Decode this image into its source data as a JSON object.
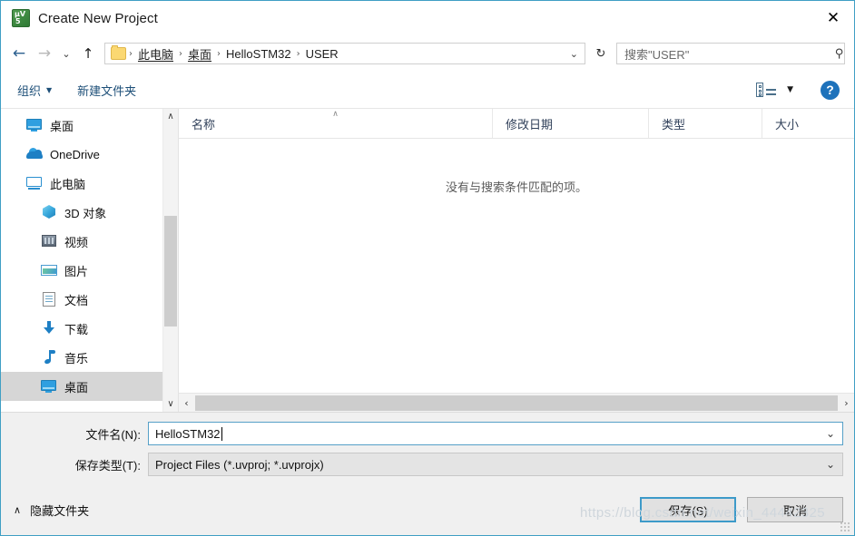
{
  "window": {
    "title": "Create New Project",
    "app_icon": "uvision-logo-icon",
    "close_label": "✕"
  },
  "navigation": {
    "back": "←",
    "forward": "→",
    "recent": "⌄",
    "up": "↑",
    "refresh": "↻",
    "dropdown": "⌄",
    "breadcrumbs": [
      {
        "label": "此电脑"
      },
      {
        "label": "桌面"
      },
      {
        "label": "HelloSTM32"
      },
      {
        "label": "USER"
      }
    ],
    "separator": "›"
  },
  "search": {
    "placeholder": "搜索\"USER\"",
    "icon": "⚲"
  },
  "toolbar": {
    "organize_label": "组织",
    "organize_caret": "▼",
    "new_folder_label": "新建文件夹",
    "view_caret": "▼",
    "help_label": "?"
  },
  "sidebar": {
    "items": [
      {
        "label": "桌面",
        "icon": "desktop-icon",
        "indent": 0,
        "selected": false
      },
      {
        "label": "OneDrive",
        "icon": "onedrive-cloud-icon",
        "indent": 0,
        "selected": false
      },
      {
        "label": "此电脑",
        "icon": "this-pc-icon",
        "indent": 0,
        "selected": false
      },
      {
        "label": "3D 对象",
        "icon": "3d-objects-icon",
        "indent": 1,
        "selected": false
      },
      {
        "label": "视频",
        "icon": "videos-icon",
        "indent": 1,
        "selected": false
      },
      {
        "label": "图片",
        "icon": "pictures-icon",
        "indent": 1,
        "selected": false
      },
      {
        "label": "文档",
        "icon": "documents-icon",
        "indent": 1,
        "selected": false
      },
      {
        "label": "下载",
        "icon": "downloads-icon",
        "indent": 1,
        "selected": false
      },
      {
        "label": "音乐",
        "icon": "music-icon",
        "indent": 1,
        "selected": false
      },
      {
        "label": "桌面",
        "icon": "desktop-icon",
        "indent": 1,
        "selected": true
      }
    ],
    "scroll_up": "∧",
    "scroll_down": "∨"
  },
  "filelist": {
    "columns": [
      {
        "label": "名称",
        "sorted": "asc",
        "sort_caret": "∧"
      },
      {
        "label": "修改日期",
        "sorted": ""
      },
      {
        "label": "类型",
        "sorted": ""
      },
      {
        "label": "大小",
        "sorted": ""
      }
    ],
    "empty_message": "没有与搜索条件匹配的项。",
    "scroll_left": "‹",
    "scroll_right": "›"
  },
  "form": {
    "filename_label": "文件名(N):",
    "filename_value": "HelloSTM32",
    "filetype_label": "保存类型(T):",
    "filetype_value": "Project Files (*.uvproj; *.uvprojx)",
    "combo_chevron": "⌄"
  },
  "actions": {
    "hide_folders_caret": "∧",
    "hide_folders_label": "隐藏文件夹",
    "save_label": "保存(S)",
    "cancel_label": "取消"
  },
  "watermark": {
    "text": "https://blog.csdn.net/weixin_44442325"
  },
  "colors": {
    "dialog_border": "#3f9fc4",
    "accent_blue": "#1e72bb",
    "link_blue": "#1d4f78",
    "selected_row": "#d6d6d6",
    "footer_bg": "#f0f0f0",
    "default_button_border": "#3d9ac9"
  }
}
